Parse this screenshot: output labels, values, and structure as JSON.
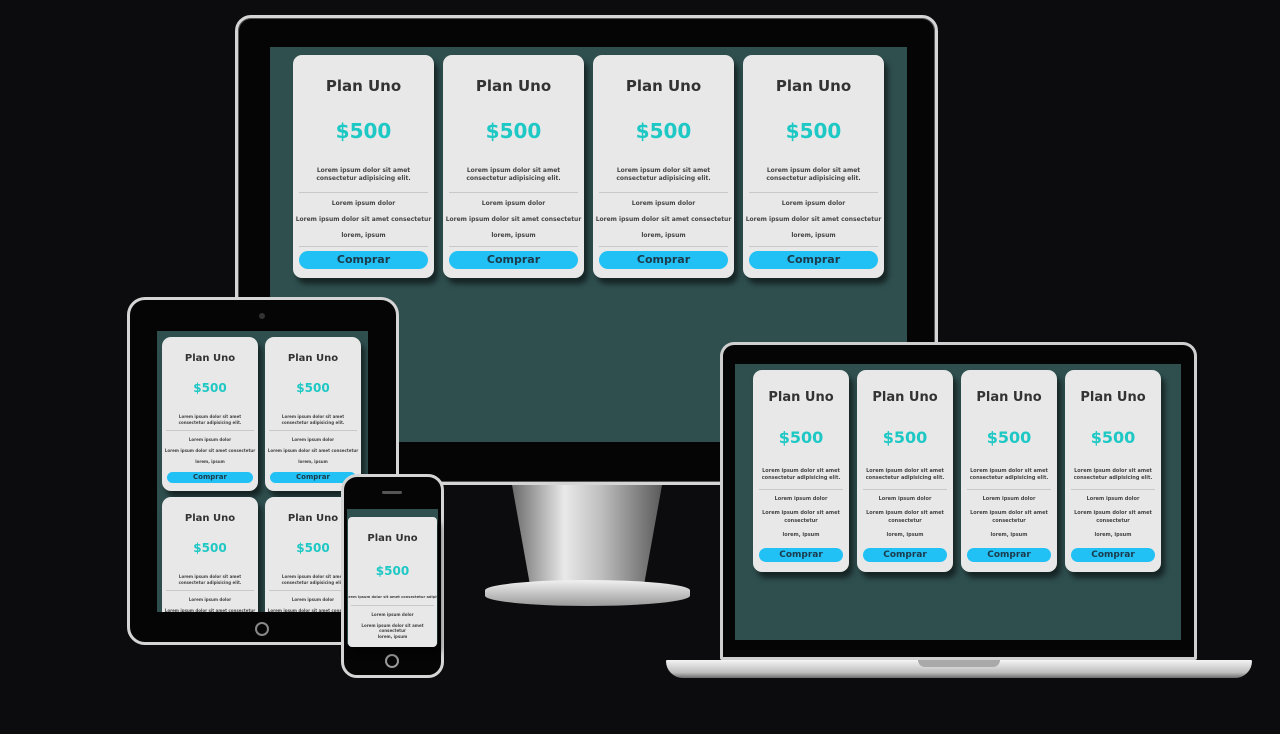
{
  "plans": {
    "title": "Plan Uno",
    "price": "$500",
    "description": "Lorem ipsum dolor sit amet consectetur adipisicing elit.",
    "feature_1": "Lorem ipsum dolor",
    "feature_2": "Lorem ipsum dolor sit amet consectetur",
    "feature_3": "lorem, ipsum",
    "button_label": "Comprar"
  },
  "colors": {
    "screen_bg": "#2f4f4f",
    "card_bg": "#e8e8e8",
    "price": "#1ec8c4",
    "button": "#21c1f5",
    "page_bg": "#0c0b0d"
  },
  "devices": [
    "desktop-monitor",
    "tablet",
    "smartphone",
    "laptop"
  ]
}
